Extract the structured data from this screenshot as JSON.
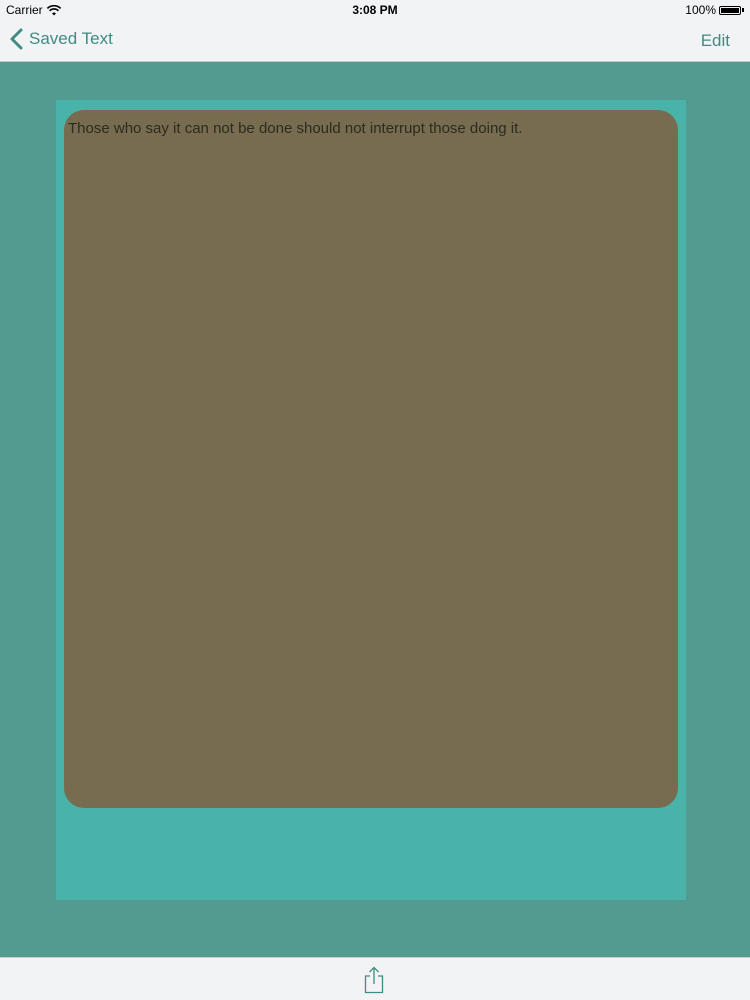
{
  "status_bar": {
    "carrier": "Carrier",
    "time": "3:08 PM",
    "battery": "100%"
  },
  "nav_bar": {
    "back_label": "Saved Text",
    "edit_label": "Edit"
  },
  "content": {
    "saved_text": "Those who say it can not be done should not interrupt those doing it."
  },
  "toolbar": {
    "share_icon": "share-icon"
  },
  "colors": {
    "tint": "#3f8c84",
    "background": "#539a91",
    "frame": "#49b3aa",
    "card": "#776c4f"
  }
}
